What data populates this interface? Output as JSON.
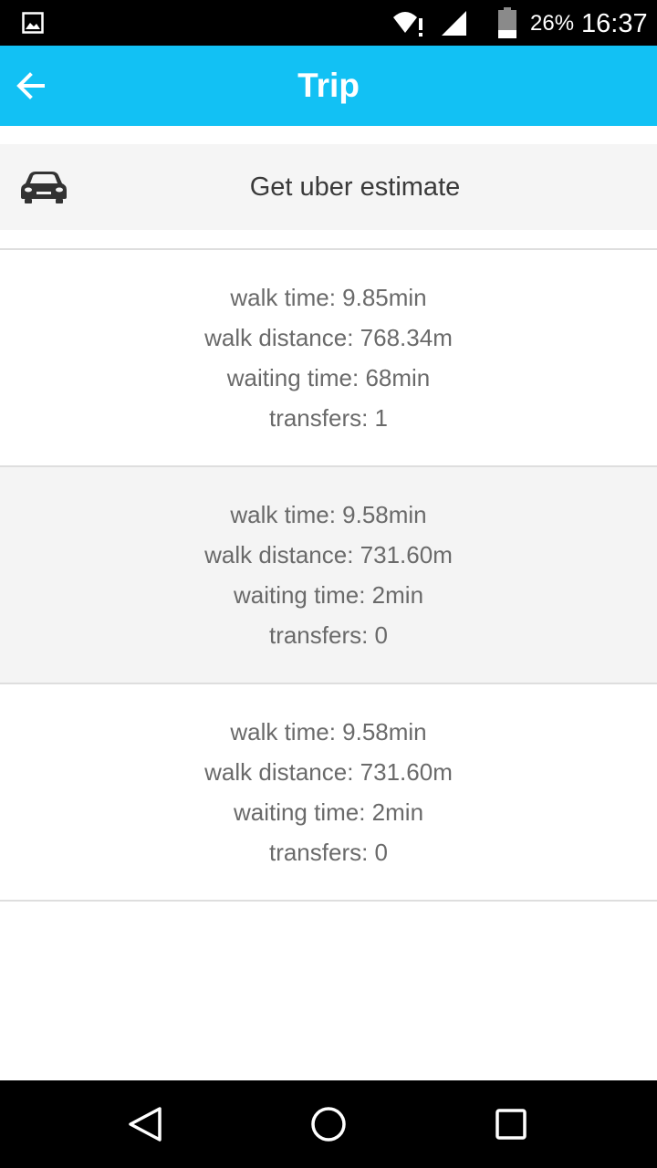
{
  "status_bar": {
    "battery": "26%",
    "time": "16:37"
  },
  "app_bar": {
    "title": "Trip",
    "background": "#12c1f4"
  },
  "uber": {
    "label": "Get uber estimate",
    "icon": "car-icon"
  },
  "trips": [
    {
      "walk_time": "walk time: 9.85min",
      "walk_distance": "walk distance: 768.34m",
      "waiting_time": "waiting time: 68min",
      "transfers": "transfers: 1"
    },
    {
      "walk_time": "walk time: 9.58min",
      "walk_distance": "walk distance: 731.60m",
      "waiting_time": "waiting time: 2min",
      "transfers": "transfers: 0"
    },
    {
      "walk_time": "walk time: 9.58min",
      "walk_distance": "walk distance: 731.60m",
      "waiting_time": "waiting time: 2min",
      "transfers": "transfers: 0"
    }
  ],
  "nav_bar": {
    "back": "triangle-back-icon",
    "home": "circle-home-icon",
    "recents": "square-recents-icon"
  }
}
